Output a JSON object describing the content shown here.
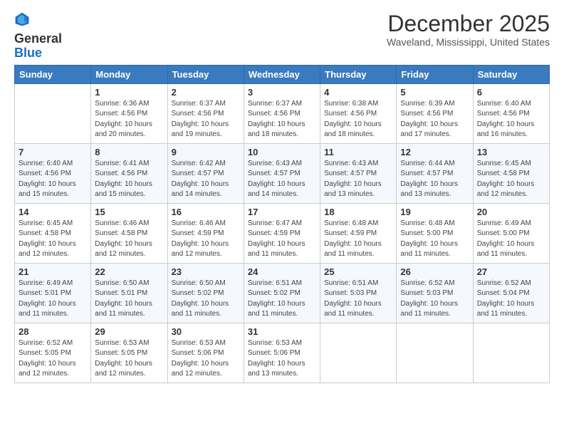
{
  "logo": {
    "general": "General",
    "blue": "Blue"
  },
  "title": "December 2025",
  "subtitle": "Waveland, Mississippi, United States",
  "days_of_week": [
    "Sunday",
    "Monday",
    "Tuesday",
    "Wednesday",
    "Thursday",
    "Friday",
    "Saturday"
  ],
  "weeks": [
    [
      {
        "day": "",
        "info": ""
      },
      {
        "day": "1",
        "info": "Sunrise: 6:36 AM\nSunset: 4:56 PM\nDaylight: 10 hours\nand 20 minutes."
      },
      {
        "day": "2",
        "info": "Sunrise: 6:37 AM\nSunset: 4:56 PM\nDaylight: 10 hours\nand 19 minutes."
      },
      {
        "day": "3",
        "info": "Sunrise: 6:37 AM\nSunset: 4:56 PM\nDaylight: 10 hours\nand 18 minutes."
      },
      {
        "day": "4",
        "info": "Sunrise: 6:38 AM\nSunset: 4:56 PM\nDaylight: 10 hours\nand 18 minutes."
      },
      {
        "day": "5",
        "info": "Sunrise: 6:39 AM\nSunset: 4:56 PM\nDaylight: 10 hours\nand 17 minutes."
      },
      {
        "day": "6",
        "info": "Sunrise: 6:40 AM\nSunset: 4:56 PM\nDaylight: 10 hours\nand 16 minutes."
      }
    ],
    [
      {
        "day": "7",
        "info": "Sunrise: 6:40 AM\nSunset: 4:56 PM\nDaylight: 10 hours\nand 15 minutes."
      },
      {
        "day": "8",
        "info": "Sunrise: 6:41 AM\nSunset: 4:56 PM\nDaylight: 10 hours\nand 15 minutes."
      },
      {
        "day": "9",
        "info": "Sunrise: 6:42 AM\nSunset: 4:57 PM\nDaylight: 10 hours\nand 14 minutes."
      },
      {
        "day": "10",
        "info": "Sunrise: 6:43 AM\nSunset: 4:57 PM\nDaylight: 10 hours\nand 14 minutes."
      },
      {
        "day": "11",
        "info": "Sunrise: 6:43 AM\nSunset: 4:57 PM\nDaylight: 10 hours\nand 13 minutes."
      },
      {
        "day": "12",
        "info": "Sunrise: 6:44 AM\nSunset: 4:57 PM\nDaylight: 10 hours\nand 13 minutes."
      },
      {
        "day": "13",
        "info": "Sunrise: 6:45 AM\nSunset: 4:58 PM\nDaylight: 10 hours\nand 12 minutes."
      }
    ],
    [
      {
        "day": "14",
        "info": "Sunrise: 6:45 AM\nSunset: 4:58 PM\nDaylight: 10 hours\nand 12 minutes."
      },
      {
        "day": "15",
        "info": "Sunrise: 6:46 AM\nSunset: 4:58 PM\nDaylight: 10 hours\nand 12 minutes."
      },
      {
        "day": "16",
        "info": "Sunrise: 6:46 AM\nSunset: 4:59 PM\nDaylight: 10 hours\nand 12 minutes."
      },
      {
        "day": "17",
        "info": "Sunrise: 6:47 AM\nSunset: 4:59 PM\nDaylight: 10 hours\nand 11 minutes."
      },
      {
        "day": "18",
        "info": "Sunrise: 6:48 AM\nSunset: 4:59 PM\nDaylight: 10 hours\nand 11 minutes."
      },
      {
        "day": "19",
        "info": "Sunrise: 6:48 AM\nSunset: 5:00 PM\nDaylight: 10 hours\nand 11 minutes."
      },
      {
        "day": "20",
        "info": "Sunrise: 6:49 AM\nSunset: 5:00 PM\nDaylight: 10 hours\nand 11 minutes."
      }
    ],
    [
      {
        "day": "21",
        "info": "Sunrise: 6:49 AM\nSunset: 5:01 PM\nDaylight: 10 hours\nand 11 minutes."
      },
      {
        "day": "22",
        "info": "Sunrise: 6:50 AM\nSunset: 5:01 PM\nDaylight: 10 hours\nand 11 minutes."
      },
      {
        "day": "23",
        "info": "Sunrise: 6:50 AM\nSunset: 5:02 PM\nDaylight: 10 hours\nand 11 minutes."
      },
      {
        "day": "24",
        "info": "Sunrise: 6:51 AM\nSunset: 5:02 PM\nDaylight: 10 hours\nand 11 minutes."
      },
      {
        "day": "25",
        "info": "Sunrise: 6:51 AM\nSunset: 5:03 PM\nDaylight: 10 hours\nand 11 minutes."
      },
      {
        "day": "26",
        "info": "Sunrise: 6:52 AM\nSunset: 5:03 PM\nDaylight: 10 hours\nand 11 minutes."
      },
      {
        "day": "27",
        "info": "Sunrise: 6:52 AM\nSunset: 5:04 PM\nDaylight: 10 hours\nand 11 minutes."
      }
    ],
    [
      {
        "day": "28",
        "info": "Sunrise: 6:52 AM\nSunset: 5:05 PM\nDaylight: 10 hours\nand 12 minutes."
      },
      {
        "day": "29",
        "info": "Sunrise: 6:53 AM\nSunset: 5:05 PM\nDaylight: 10 hours\nand 12 minutes."
      },
      {
        "day": "30",
        "info": "Sunrise: 6:53 AM\nSunset: 5:06 PM\nDaylight: 10 hours\nand 12 minutes."
      },
      {
        "day": "31",
        "info": "Sunrise: 6:53 AM\nSunset: 5:06 PM\nDaylight: 10 hours\nand 13 minutes."
      },
      {
        "day": "",
        "info": ""
      },
      {
        "day": "",
        "info": ""
      },
      {
        "day": "",
        "info": ""
      }
    ]
  ]
}
